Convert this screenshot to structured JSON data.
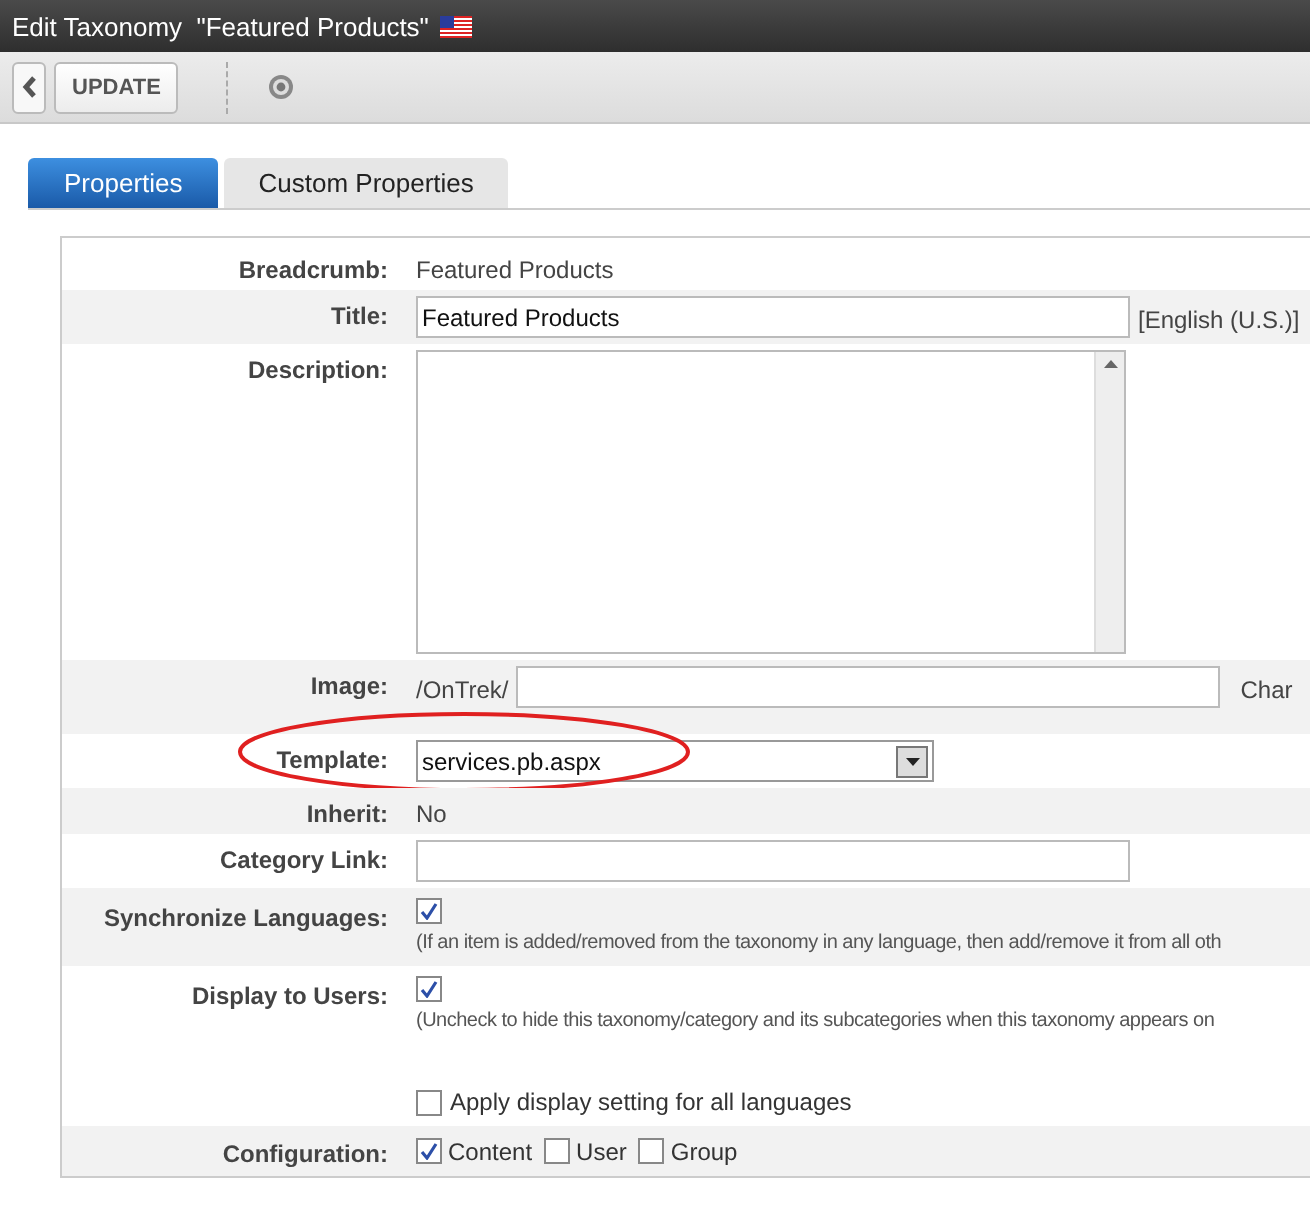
{
  "window": {
    "title": "Edit Taxonomy  \"Featured Products\""
  },
  "toolbar": {
    "update_button": "UPDATE"
  },
  "tabs": [
    {
      "label": "Properties",
      "selected": true
    },
    {
      "label": "Custom Properties",
      "selected": false
    }
  ],
  "form": [
    {
      "kind": "text",
      "label": "Breadcrumb:",
      "value": "Featured Products"
    },
    {
      "kind": "input",
      "label": "Title:",
      "value": "Featured Products",
      "suffix": "[English (U.S.)]"
    },
    {
      "kind": "textarea",
      "label": "Description:"
    },
    {
      "kind": "image",
      "label": "Image:",
      "prefix": "/OnTrek/",
      "suffix": "Char"
    },
    {
      "kind": "select",
      "label": "Template:",
      "value": "services.pb.aspx",
      "highlighted": true
    },
    {
      "kind": "text",
      "label": "Inherit:",
      "value": "No"
    },
    {
      "kind": "input",
      "label": "Category Link:"
    },
    {
      "kind": "checkbox",
      "label": "Synchronize Languages:",
      "checked": true,
      "note": "(If an item is added/removed from the taxonomy in any language, then add/remove it from all oth"
    },
    {
      "kind": "checkbox",
      "label": "Display to Users:",
      "checked": true,
      "note": "(Uncheck to hide this taxonomy/category and its subcategories when this taxonomy appears on",
      "extra": {
        "label": "Apply display setting for all languages",
        "checked": false
      }
    },
    {
      "kind": "options",
      "label": "Configuration:",
      "options": [
        {
          "label": "Content",
          "checked": true
        },
        {
          "label": "User",
          "checked": false
        },
        {
          "label": "Group",
          "checked": false
        }
      ]
    }
  ]
}
